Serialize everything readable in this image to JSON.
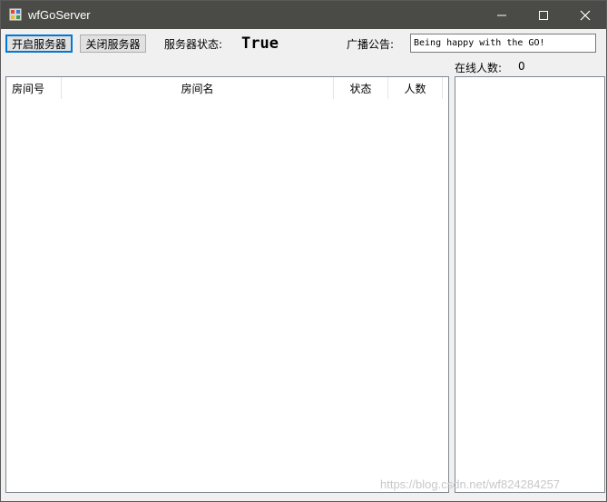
{
  "window": {
    "title": "wfGoServer"
  },
  "toolbar": {
    "start_label": "开启服务器",
    "stop_label": "关闭服务器",
    "status_label": "服务器状态:",
    "status_value": "True",
    "broadcast_label": "广播公告:",
    "broadcast_value": "Being happy with the GO!",
    "online_label": "在线人数:",
    "online_count": "0"
  },
  "room_list": {
    "columns": [
      "房间号",
      "房间名",
      "状态",
      "人数"
    ],
    "rows": []
  },
  "watermark": "https://blog.csdn.net/wf824284257",
  "icons": [
    "app-icon",
    "minimize-icon",
    "maximize-icon",
    "close-icon"
  ],
  "colors": {
    "titlebar": "#4a4a47",
    "window_bg": "#f0f0f0",
    "focus_border": "#0078d7"
  }
}
